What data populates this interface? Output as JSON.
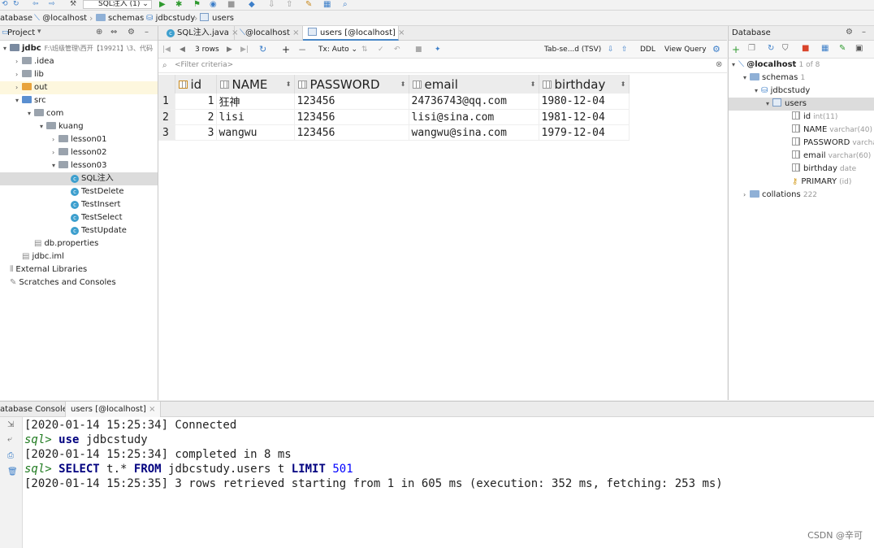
{
  "toolbar": {
    "run_config": "SQL注入 (1)"
  },
  "breadcrumbs": [
    "atabase",
    "@localhost",
    "schemas",
    "jdbcstudy",
    "users"
  ],
  "project_panel": {
    "title": "Project",
    "tree": [
      {
        "label": "jdbc",
        "extra": "F:\\班级管理\\西开【19921】\\3、代码",
        "level": 0,
        "type": "module",
        "expanded": true
      },
      {
        "label": ".idea",
        "level": 1,
        "type": "folder",
        "expanded": false
      },
      {
        "label": "lib",
        "level": 1,
        "type": "folder",
        "expanded": false
      },
      {
        "label": "out",
        "level": 1,
        "type": "folder-orange",
        "expanded": false
      },
      {
        "label": "src",
        "level": 1,
        "type": "folder-blue",
        "expanded": true
      },
      {
        "label": "com",
        "level": 2,
        "type": "folder",
        "expanded": true
      },
      {
        "label": "kuang",
        "level": 3,
        "type": "folder",
        "expanded": true
      },
      {
        "label": "lesson01",
        "level": 4,
        "type": "folder",
        "expanded": false
      },
      {
        "label": "lesson02",
        "level": 4,
        "type": "folder",
        "expanded": false
      },
      {
        "label": "lesson03",
        "level": 4,
        "type": "folder",
        "expanded": true
      },
      {
        "label": "SQL注入",
        "level": 5,
        "type": "class",
        "selected": true
      },
      {
        "label": "TestDelete",
        "level": 5,
        "type": "class"
      },
      {
        "label": "TestInsert",
        "level": 5,
        "type": "class"
      },
      {
        "label": "TestSelect",
        "level": 5,
        "type": "class"
      },
      {
        "label": "TestUpdate",
        "level": 5,
        "type": "class"
      },
      {
        "label": "db.properties",
        "level": 2,
        "type": "file"
      },
      {
        "label": "jdbc.iml",
        "level": 1,
        "type": "file"
      },
      {
        "label": "External Libraries",
        "level": 0,
        "type": "libs"
      },
      {
        "label": "Scratches and Consoles",
        "level": 0,
        "type": "scratch"
      }
    ]
  },
  "editor_tabs": [
    {
      "label": "SQL注入.java",
      "active": false
    },
    {
      "label": "@localhost",
      "active": false
    },
    {
      "label": "users [@localhost]",
      "active": true
    }
  ],
  "grid_toolbar": {
    "rows": "3 rows",
    "tx": "Tx: Auto",
    "export": "Tab-se...d (TSV)",
    "ddl": "DDL",
    "view_query": "View Query"
  },
  "filter_placeholder": "<Filter criteria>",
  "grid": {
    "columns": [
      "id",
      "NAME",
      "PASSWORD",
      "email",
      "birthday"
    ],
    "rows": [
      {
        "n": "1",
        "id": "1",
        "name": "狂神",
        "password": "123456",
        "email": "24736743@qq.com",
        "birthday": "1980-12-04"
      },
      {
        "n": "2",
        "id": "2",
        "name": "lisi",
        "password": "123456",
        "email": "lisi@sina.com",
        "birthday": "1981-12-04"
      },
      {
        "n": "3",
        "id": "3",
        "name": "wangwu",
        "password": "123456",
        "email": "wangwu@sina.com",
        "birthday": "1979-12-04"
      }
    ]
  },
  "database_panel": {
    "title": "Database",
    "host": "@localhost",
    "host_count": "1 of 8",
    "schemas": "schemas",
    "schemas_count": "1",
    "db": "jdbcstudy",
    "table": "users",
    "columns": [
      {
        "name": "id",
        "type": "int(11)"
      },
      {
        "name": "NAME",
        "type": "varchar(40)"
      },
      {
        "name": "PASSWORD",
        "type": "varchar"
      },
      {
        "name": "email",
        "type": "varchar(60)"
      },
      {
        "name": "birthday",
        "type": "date"
      },
      {
        "name": "PRIMARY",
        "type": "(id)"
      }
    ],
    "collations": "collations",
    "collations_count": "222"
  },
  "console": {
    "tab_title": "atabase Console:",
    "tab": "users [@localhost]",
    "lines": {
      "l1": "[2020-01-14 15:25:34] Connected",
      "l2_prompt": "sql>",
      "l2_kw": "use",
      "l2_rest": " jdbcstudy",
      "l3": "[2020-01-14 15:25:34] completed in 8 ms",
      "l4_prompt": "sql>",
      "l4_kw1": "SELECT",
      "l4_a": " t.* ",
      "l4_kw2": "FROM",
      "l4_b": " jdbcstudy.users t ",
      "l4_kw3": "LIMIT",
      "l4_num": " 501",
      "l5": "[2020-01-14 15:25:35] 3 rows retrieved starting from 1 in 605 ms (execution: 352 ms, fetching: 253 ms)"
    }
  },
  "watermark": "CSDN @辛可"
}
